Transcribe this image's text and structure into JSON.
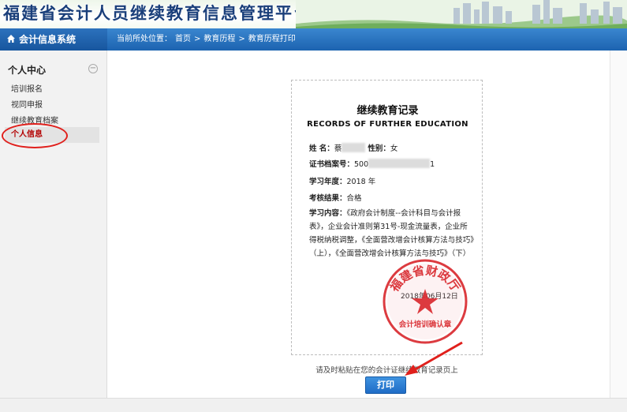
{
  "header": {
    "title": "福建省会计人员继续教育信息管理平台"
  },
  "nav": {
    "system_name": "会计信息系统",
    "breadcrumb": [
      "当前所处位置：",
      "首页",
      ">",
      "教育历程",
      ">",
      "教育历程打印"
    ]
  },
  "sidebar": {
    "section_title": "个人中心",
    "toggle_symbol": "−",
    "items": [
      {
        "label": "培训报名"
      },
      {
        "label": "视同申报"
      },
      {
        "label": "继续教育档案"
      },
      {
        "label": "个人信息",
        "active": true
      }
    ]
  },
  "certificate": {
    "title": "继续教育记录",
    "subtitle": "RECORDS OF FURTHER EDUCATION",
    "name_label": "姓 名：",
    "name_value": "蔡",
    "gender_label": "性别：",
    "gender_value": "女",
    "file_no_label": "证书档案号：",
    "file_no_prefix": "500",
    "file_no_suffix": "1",
    "year_label": "学习年度：",
    "year_value": "2018 年",
    "result_label": "考核结果：",
    "result_value": "合格",
    "content_label": "学习内容：",
    "content_value": "《政府会计制度--会计科目与会计报表》，企业会计准则第31号-现金流量表，企业所得税纳税调整，《全面营改增会计核算方法与技巧》（上），《全面营改增会计核算方法与技巧》（下）",
    "date": "2018年06月12日",
    "seal_text_top": "福建省财政厅",
    "seal_text_bottom": "会计培训确认章"
  },
  "footer": {
    "note": "请及时粘贴在您的会计证继续教育记录页上",
    "print_label": "打印"
  },
  "colors": {
    "nav_blue": "#1c63b0",
    "seal_red": "#d8262b",
    "annotation_red": "#e0201c",
    "title_blue": "#1a3f7a"
  }
}
